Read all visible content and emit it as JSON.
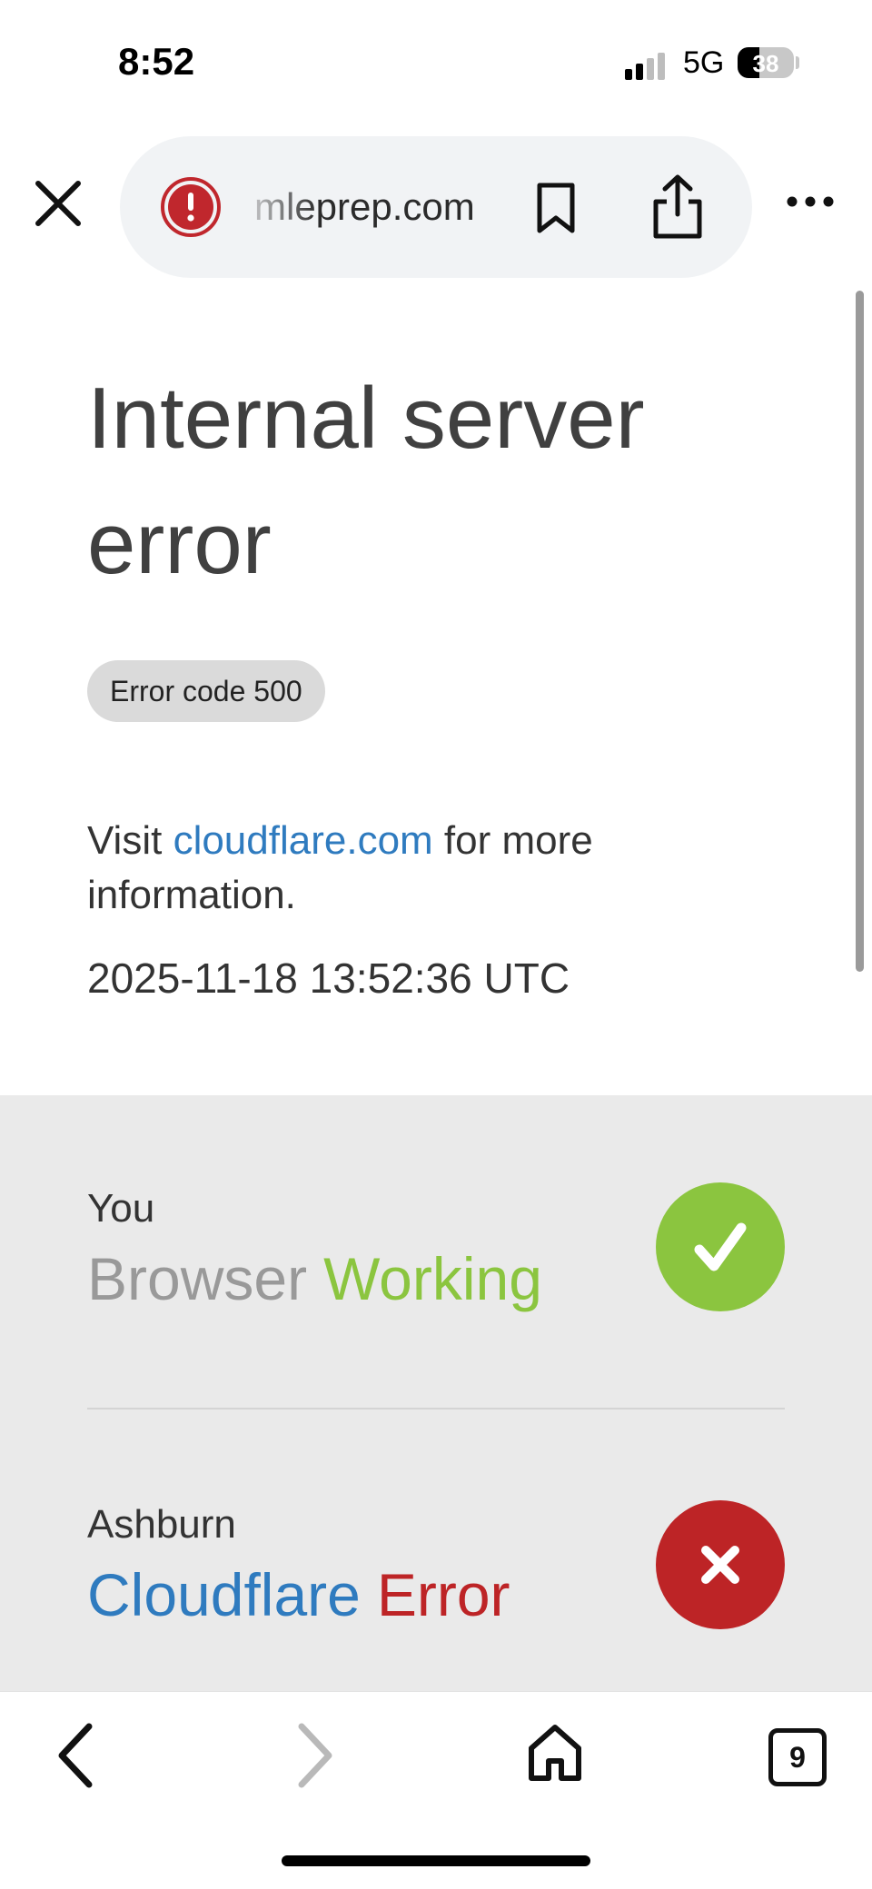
{
  "status_bar": {
    "time": "8:52",
    "network": "5G",
    "battery": "38"
  },
  "browser": {
    "url": "mleprep.com",
    "icons": {
      "close": "close-icon",
      "alert": "alert-icon",
      "bookmark": "bookmark-icon",
      "share": "share-icon",
      "more": "more-icon"
    }
  },
  "page": {
    "title": "Internal server error",
    "error_code": "Error code 500",
    "visit_prefix": "Visit ",
    "visit_link": "cloudflare.com",
    "visit_suffix": " for more information.",
    "timestamp": "2025-11-18 13:52:36 UTC"
  },
  "status_rows": [
    {
      "location": "You",
      "name": "Browser",
      "state": "Working",
      "state_color": "#8bc53f",
      "name_color": "#999999",
      "icon": "check-icon"
    },
    {
      "location": "Ashburn",
      "name": "Cloudflare",
      "state": "Error",
      "state_color": "#bd2426",
      "name_color": "#2f7bbf",
      "icon": "x-icon"
    }
  ],
  "bottom_nav": {
    "tab_count": "9",
    "icons": [
      "back-icon",
      "forward-icon",
      "home-icon",
      "tabs-icon"
    ]
  }
}
